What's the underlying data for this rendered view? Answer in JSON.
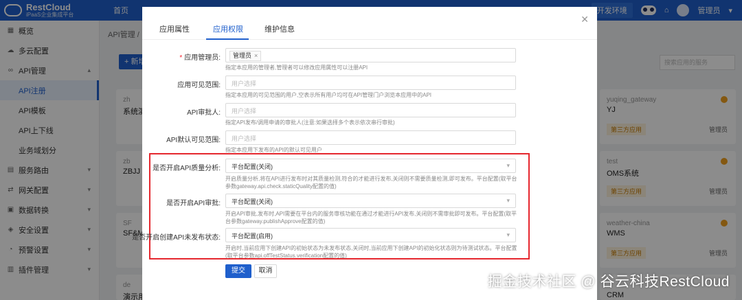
{
  "app": {
    "brand": "RestCloud",
    "subtitle": "iPaaS企业集成平台",
    "home": "首页",
    "env_button": "开发环境",
    "user": "管理员"
  },
  "sidebar": {
    "items": [
      {
        "label": "概览",
        "icon": "grid-icon"
      },
      {
        "label": "多云配置",
        "icon": "cloud-icon"
      },
      {
        "label": "API管理",
        "icon": "link-icon"
      },
      {
        "label": "API注册",
        "active": true
      },
      {
        "label": "API模板"
      },
      {
        "label": "API上下线"
      },
      {
        "label": "业务域划分"
      },
      {
        "label": "服务路由",
        "icon": "route-icon"
      },
      {
        "label": "网关配置",
        "icon": "gateway-icon"
      },
      {
        "label": "数据转换",
        "icon": "transform-icon"
      },
      {
        "label": "安全设置",
        "icon": "shield-icon"
      },
      {
        "label": "预警设置",
        "icon": "bell-icon"
      },
      {
        "label": "插件管理",
        "icon": "plugin-icon"
      }
    ]
  },
  "background": {
    "breadcrumb": "API管理 /",
    "add_button": "+ 新增",
    "search_placeholder": "搜索应用的服务",
    "cards_left": [
      {
        "tag": "zh",
        "name": "系统演"
      },
      {
        "tag": "zb",
        "name": "ZBJJ"
      },
      {
        "tag": "SF",
        "name": "SF&M"
      },
      {
        "tag": "de",
        "name": "演示用"
      }
    ],
    "cards_right": [
      {
        "tag": "yuqing_gateway",
        "name": "YJ",
        "badge": "第三方应用",
        "owner": "管理员"
      },
      {
        "tag": "test",
        "name": "OMS系统",
        "badge": "第三方应用",
        "owner": "管理员"
      },
      {
        "tag": "weather-china",
        "name": "WMS",
        "badge": "第三方应用",
        "owner": "管理员"
      },
      {
        "tag": "",
        "name": "CRM"
      }
    ]
  },
  "modal": {
    "tabs": [
      "应用属性",
      "应用权限",
      "维护信息"
    ],
    "active_tab": "应用权限",
    "fields": {
      "admin": {
        "label": "应用管理员:",
        "chip": "管理员",
        "help": "指定本应用的管理者,管理者可以修改应用属性可以注册API"
      },
      "visible": {
        "label": "应用可见范围:",
        "placeholder": "用户选择",
        "help": "指定本应用的可见范围的用户,空表示所有用户均可在API管理门户浏览本应用中的API"
      },
      "approver": {
        "label": "API审批人:",
        "placeholder": "用户选择",
        "help": "指定API发布/调用申请的审批人(注意:如果选择多个表示依次串行审批)"
      },
      "default_visible": {
        "label": "API默认可见范围:",
        "placeholder": "用户选择",
        "help": "指定本应用下发布的API的默认可见用户"
      },
      "quality": {
        "label": "是否开启API质量分析:",
        "value": "平台配置(关闭)",
        "help": "开启质量分析,将在API进行发布时对其质量检测,符合的才能进行发布,关闭则不需要质量检测,即可发布。平台配置(取平台参数gateway.api.check.staticQuality配置的值)"
      },
      "review": {
        "label": "是否开启API审批:",
        "value": "平台配置(关闭)",
        "help": "开启API审批,发布时,API需要在平台内的服务审核功能在通过才能进行API发布,关闭则不需审批即可发布。平台配置(取平台参数gateway.publishApprove配置的值)"
      },
      "unpublished": {
        "label": "是否开启创建API未发布状态:",
        "value": "平台配置(启用)",
        "help": "开启时,当前应用下创建API的初始状态为未发布状态,关闭时,当前应用下创建API的初始化状态则为待测试状态。平台配置(取平台参数api.offTestStatus.verification配置的值)"
      }
    },
    "submit": "提交",
    "cancel": "取消"
  },
  "watermark": "掘金技术社区 @ 谷云科技RestCloud"
}
